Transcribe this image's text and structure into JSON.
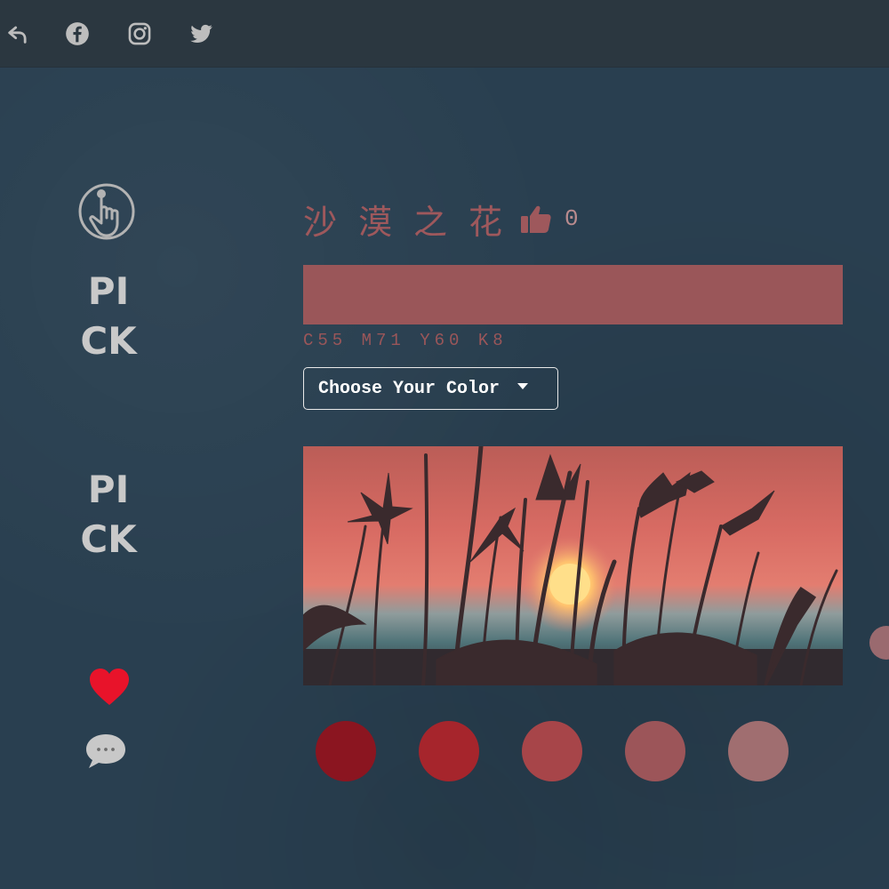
{
  "topbar": {
    "icons": [
      "back-arrow-icon",
      "facebook-icon",
      "instagram-icon",
      "twitter-icon"
    ]
  },
  "brand": {
    "word_1": "PICK",
    "word_2": "PICK",
    "logo_icon": "hand-pointer-circle-icon"
  },
  "color": {
    "name": "沙漠之花",
    "like_count": "0",
    "swatch_hex": "#9a5659",
    "cmyk": "C55 M71 Y60 K8"
  },
  "dropdown": {
    "label": "Choose Your Color"
  },
  "palette": {
    "swatches": [
      "#8b1520",
      "#a6252c",
      "#a74549",
      "#9c5559",
      "#a06e70"
    ]
  },
  "colors": {
    "background": "#293f50",
    "topbar": "#2b3740",
    "accent": "#9a5659",
    "heart": "#e8132a"
  }
}
